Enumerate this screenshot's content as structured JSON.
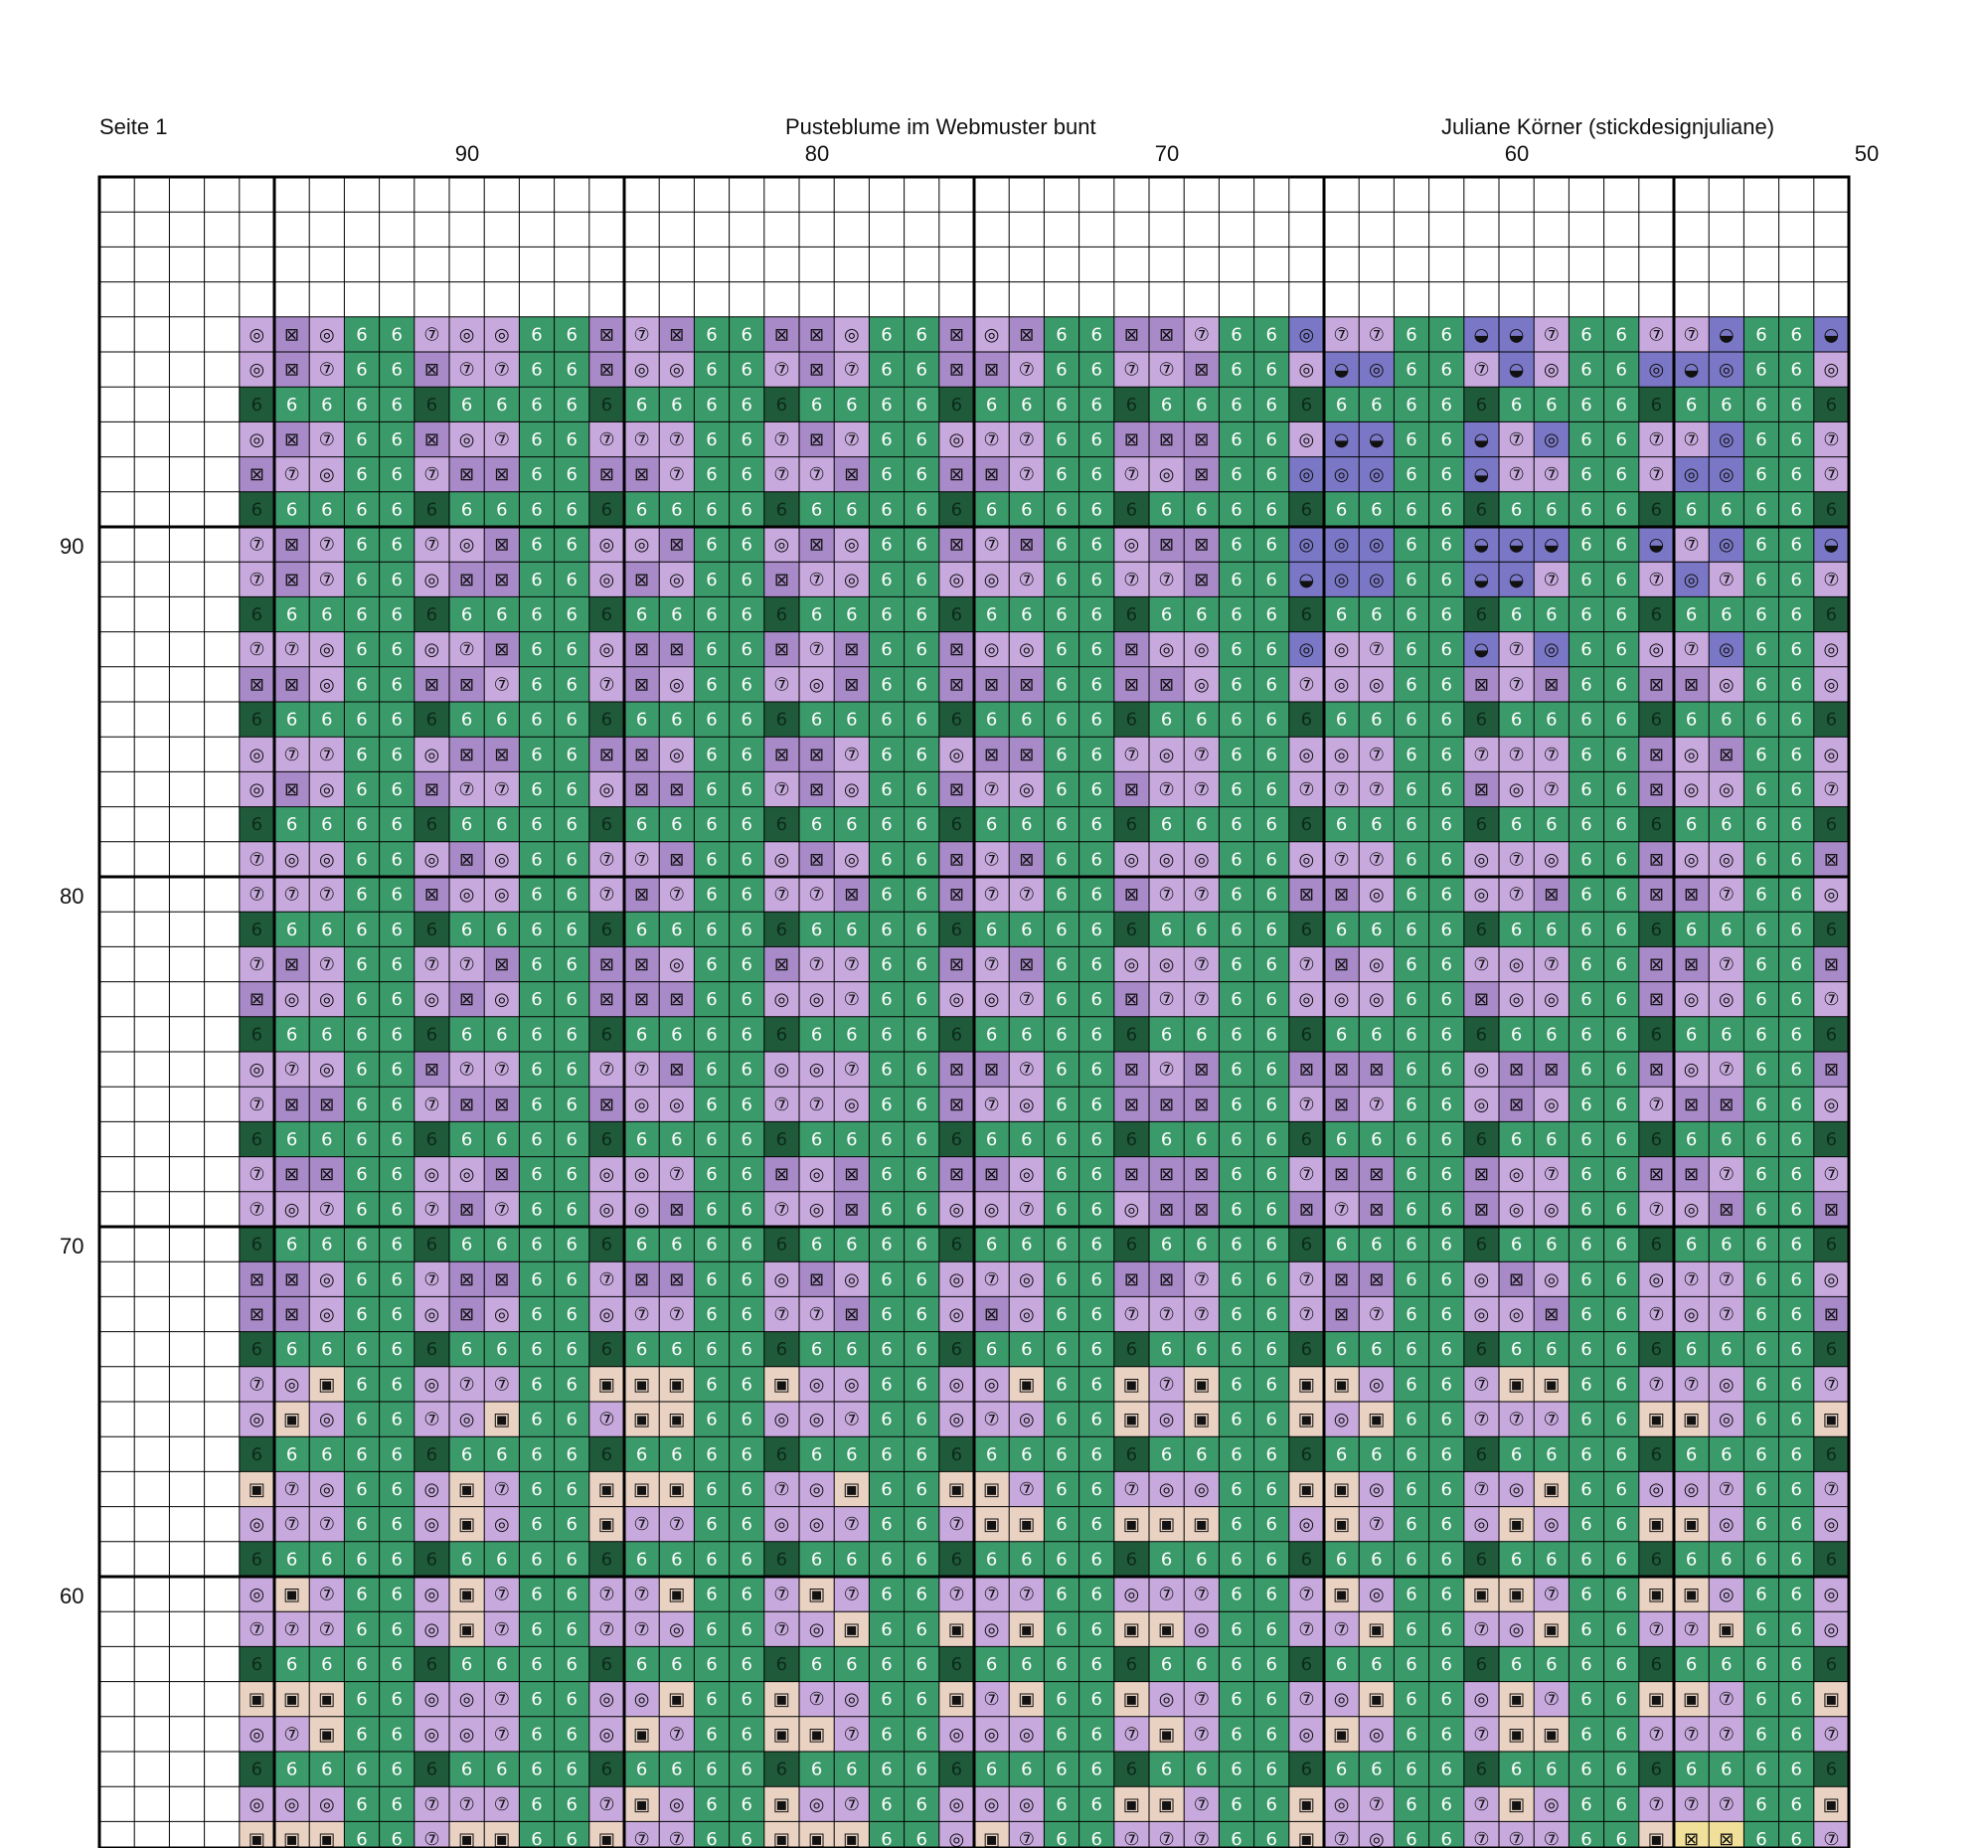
{
  "header": {
    "page_label": "Seite 1",
    "title": "Pusteblume im Webmuster bunt",
    "author": "Juliane Körner (stickdesignjuliane)"
  },
  "axis": {
    "top_ticks": [
      "90",
      "80",
      "70",
      "60",
      "50"
    ],
    "left_ticks": [
      "90",
      "80",
      "70",
      "60"
    ]
  },
  "colors": {
    "grid_line": "#000000",
    "green_background": "#3a9a6a",
    "dark_green_dot": "#1f5a3a",
    "purple_light": "#c7a9dd",
    "purple_mid": "#a98ac9",
    "blue_violet": "#7a78c6",
    "peach": "#e9d2c2",
    "yellow": "#f0e09a"
  },
  "symbols": {
    "six": "6",
    "circle": "◎",
    "half_circle": "◒",
    "square": "▣",
    "x_square": "⊠",
    "corner": "◸",
    "black_square": "■",
    "circle_seven": "⑦",
    "circle_one": "①"
  }
}
